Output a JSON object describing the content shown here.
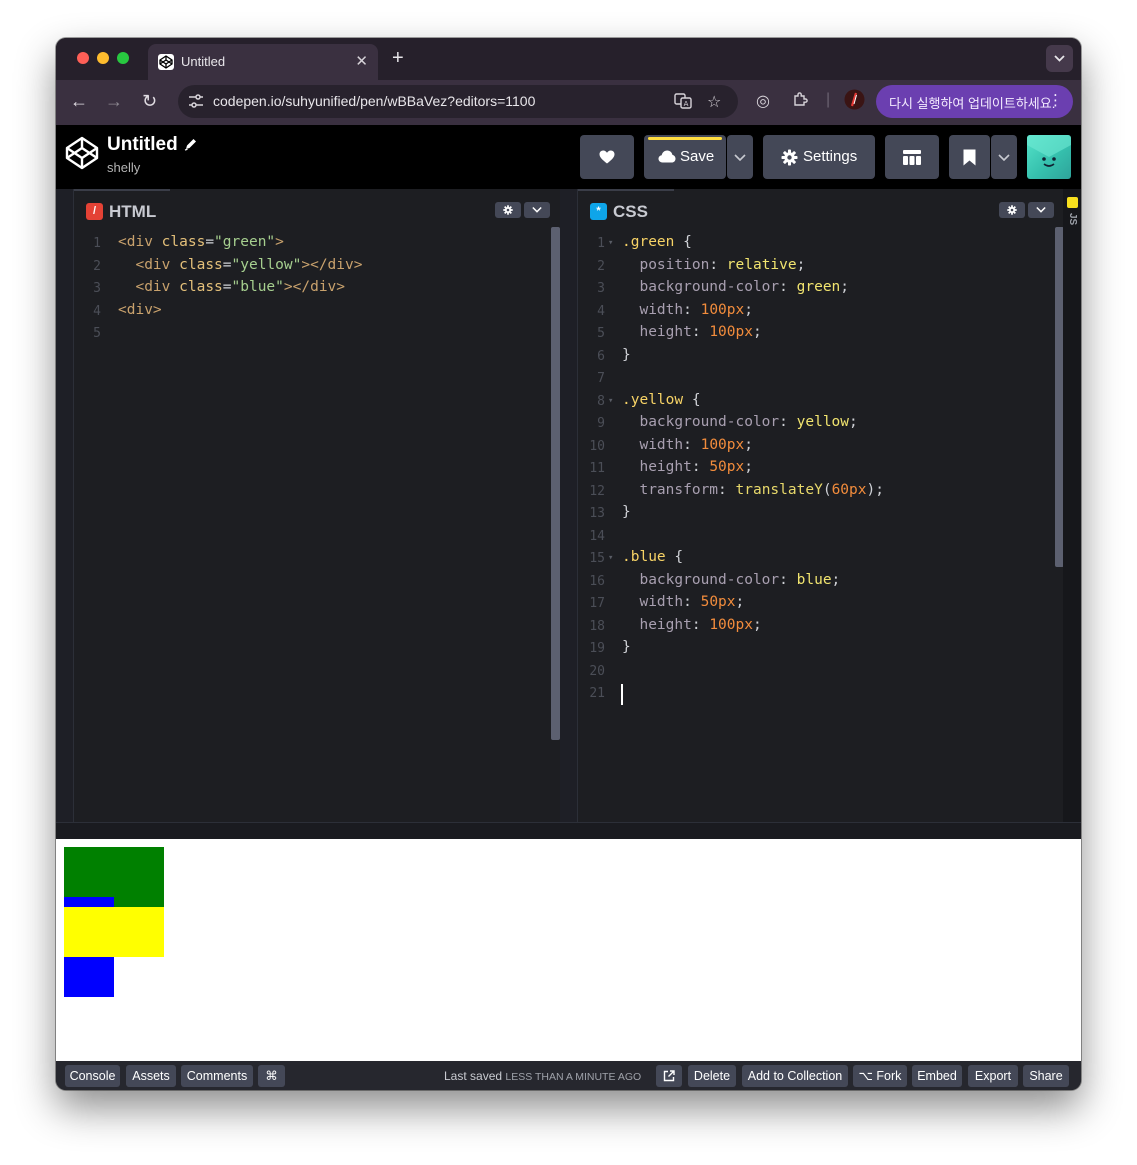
{
  "browser": {
    "tab_title": "Untitled",
    "url": "codepen.io/suhyunified/pen/wBBaVez?editors=1100",
    "update_label": "다시 실행하여 업데이트하세요."
  },
  "pen": {
    "title": "Untitled",
    "user": "shelly"
  },
  "header": {
    "save_label": "Save",
    "settings_label": "Settings"
  },
  "editors": {
    "html": {
      "name": "HTML",
      "line_numbers": [
        "1",
        "2",
        "3",
        "4",
        "5"
      ]
    },
    "css": {
      "name": "CSS",
      "line_numbers": [
        "1",
        "2",
        "3",
        "4",
        "5",
        "6",
        "7",
        "8",
        "9",
        "10",
        "11",
        "12",
        "13",
        "14",
        "15",
        "16",
        "17",
        "18",
        "19",
        "20",
        "21"
      ]
    },
    "js_label": "JS"
  },
  "footer": {
    "console": "Console",
    "assets": "Assets",
    "comments": "Comments",
    "shortcuts": "⌘",
    "last_saved": "Last saved",
    "last_saved_ago": "LESS THAN A MINUTE AGO",
    "delete": "Delete",
    "add_to_collection": "Add to Collection",
    "fork": "⌥ Fork",
    "embed": "Embed",
    "export": "Export",
    "share": "Share"
  },
  "preview_colors": {
    "green": "#008000",
    "yellow": "#ffff00",
    "blue": "#0000ff"
  }
}
